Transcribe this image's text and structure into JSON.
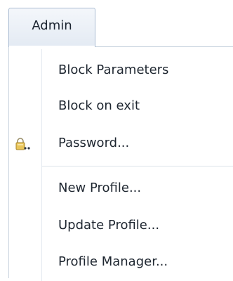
{
  "menu": {
    "title": "Admin",
    "items": [
      {
        "label": "Block Parameters",
        "icon": null
      },
      {
        "label": "Block on exit",
        "icon": null
      },
      {
        "label": "Password...",
        "icon": "lock-key-icon"
      },
      {
        "label": "New Profile...",
        "icon": null
      },
      {
        "label": "Update Profile...",
        "icon": null
      },
      {
        "label": "Profile Manager...",
        "icon": null
      }
    ]
  }
}
